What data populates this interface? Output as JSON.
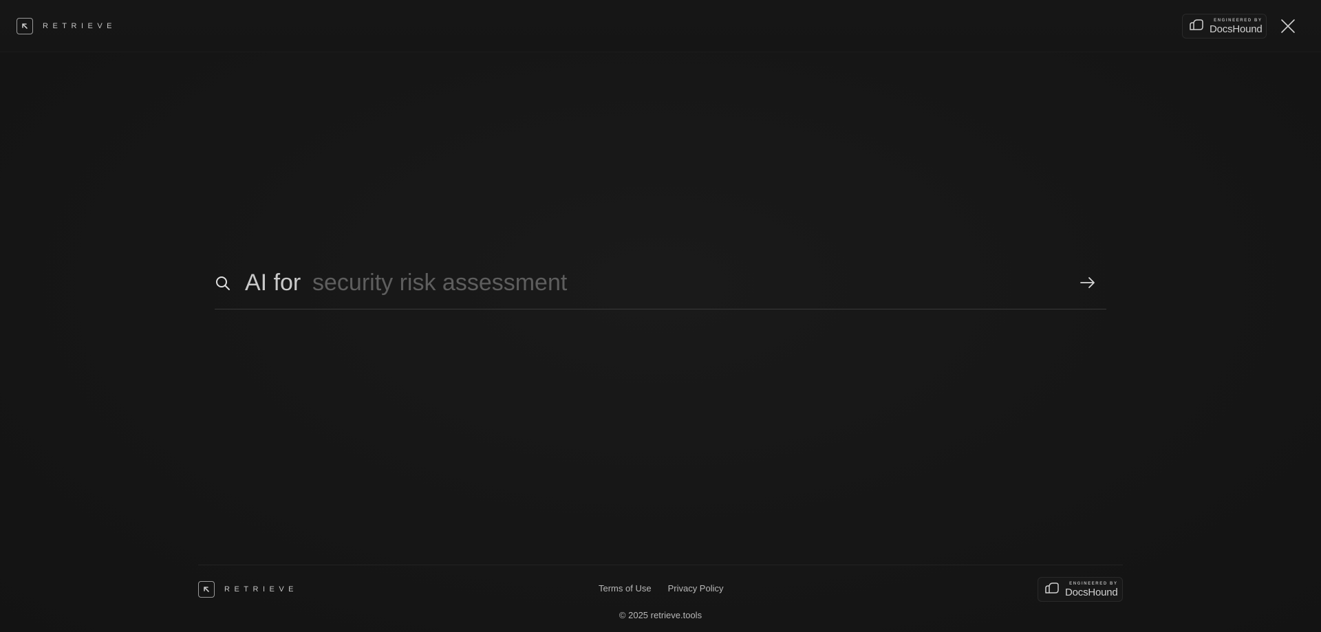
{
  "header": {
    "brand_text": "RETRIEVE",
    "badge_engineered": "ENGINEERED BY",
    "badge_name": "DocsHound",
    "close_icon": "close-icon"
  },
  "search": {
    "prefix": "AI for",
    "placeholder": "security risk assessment",
    "value": "",
    "search_icon": "search-icon",
    "submit_icon": "arrow-right-icon"
  },
  "footer": {
    "brand_text": "RETRIEVE",
    "links": [
      {
        "label": "Terms of Use"
      },
      {
        "label": "Privacy Policy"
      }
    ],
    "badge_engineered": "ENGINEERED BY",
    "badge_name": "DocsHound",
    "copyright": "© 2025 retrieve.tools"
  },
  "colors": {
    "background": "#151515",
    "text": "#d8d8d8",
    "placeholder": "#5e5e5e",
    "divider": "#3a3a3a"
  }
}
